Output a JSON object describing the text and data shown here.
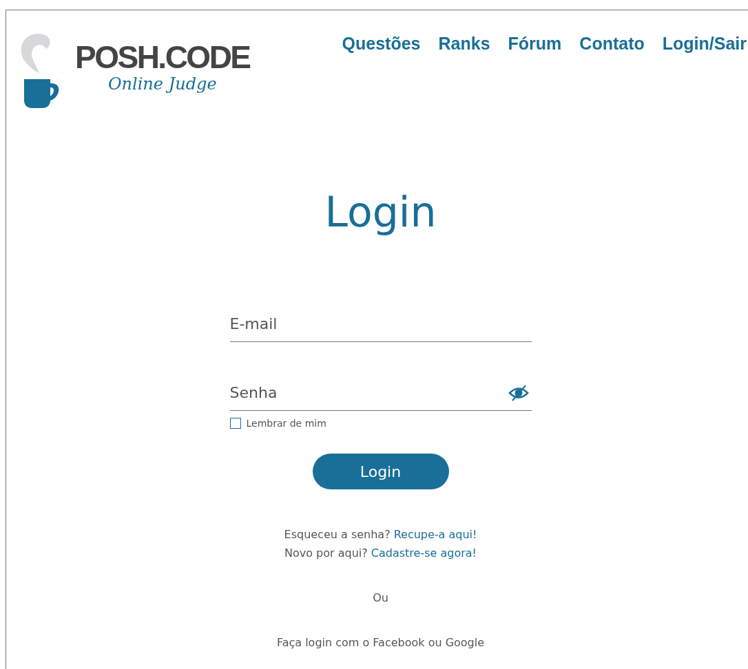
{
  "logo": {
    "name": "POSH.CODE",
    "tagline": "Online Judge"
  },
  "nav": [
    {
      "label": "Questões"
    },
    {
      "label": "Ranks"
    },
    {
      "label": "Fórum"
    },
    {
      "label": "Contato"
    },
    {
      "label": "Login/Sair"
    }
  ],
  "title": "Login",
  "fields": [
    {
      "placeholder": "E-mail",
      "kind": "email"
    },
    {
      "placeholder": "Senha",
      "kind": "password"
    }
  ],
  "remember": {
    "label": "Lembrar de mim",
    "checked": false
  },
  "submit": "Login",
  "help": [
    {
      "text": "Esqueceu a senha?",
      "link": "Recupe-a aqui!"
    },
    {
      "text": "Novo por aqui?",
      "link": "Cadastre-se agora!"
    }
  ],
  "separator": "Ou",
  "social": "Faça login com o Facebook ou Google"
}
